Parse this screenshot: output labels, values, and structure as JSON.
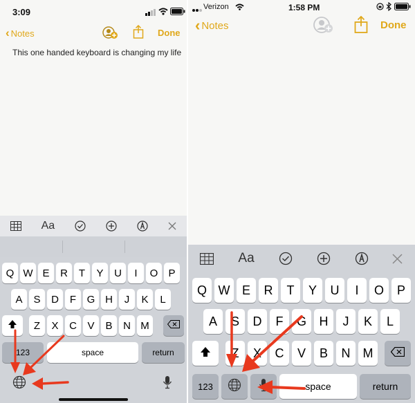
{
  "left": {
    "status": {
      "time": "3:09"
    },
    "nav": {
      "back_label": "Notes",
      "done_label": "Done"
    },
    "note_text": "This one handed keyboard is changing my life",
    "toolbar": {
      "format_label": "Aa"
    },
    "keyboard": {
      "row1": [
        "Q",
        "W",
        "E",
        "R",
        "T",
        "Y",
        "U",
        "I",
        "O",
        "P"
      ],
      "row2": [
        "A",
        "S",
        "D",
        "F",
        "G",
        "H",
        "J",
        "K",
        "L"
      ],
      "row3": [
        "Z",
        "X",
        "C",
        "V",
        "B",
        "N",
        "M"
      ],
      "numbers_label": "123",
      "space_label": "space",
      "return_label": "return"
    }
  },
  "right": {
    "status": {
      "carrier": "Verizon",
      "time": "1:58 PM"
    },
    "nav": {
      "back_label": "Notes",
      "done_label": "Done"
    },
    "toolbar": {
      "format_label": "Aa"
    },
    "keyboard": {
      "row1": [
        "Q",
        "W",
        "E",
        "R",
        "T",
        "Y",
        "U",
        "I",
        "O",
        "P"
      ],
      "row2": [
        "A",
        "S",
        "D",
        "F",
        "G",
        "H",
        "J",
        "K",
        "L"
      ],
      "row3": [
        "Z",
        "X",
        "C",
        "V",
        "B",
        "N",
        "M"
      ],
      "numbers_label": "123",
      "space_label": "space",
      "return_label": "return"
    }
  },
  "colors": {
    "accent": "#e0a81b",
    "arrow": "#e8391e",
    "keyboard_bg": "#d0d3d8"
  }
}
